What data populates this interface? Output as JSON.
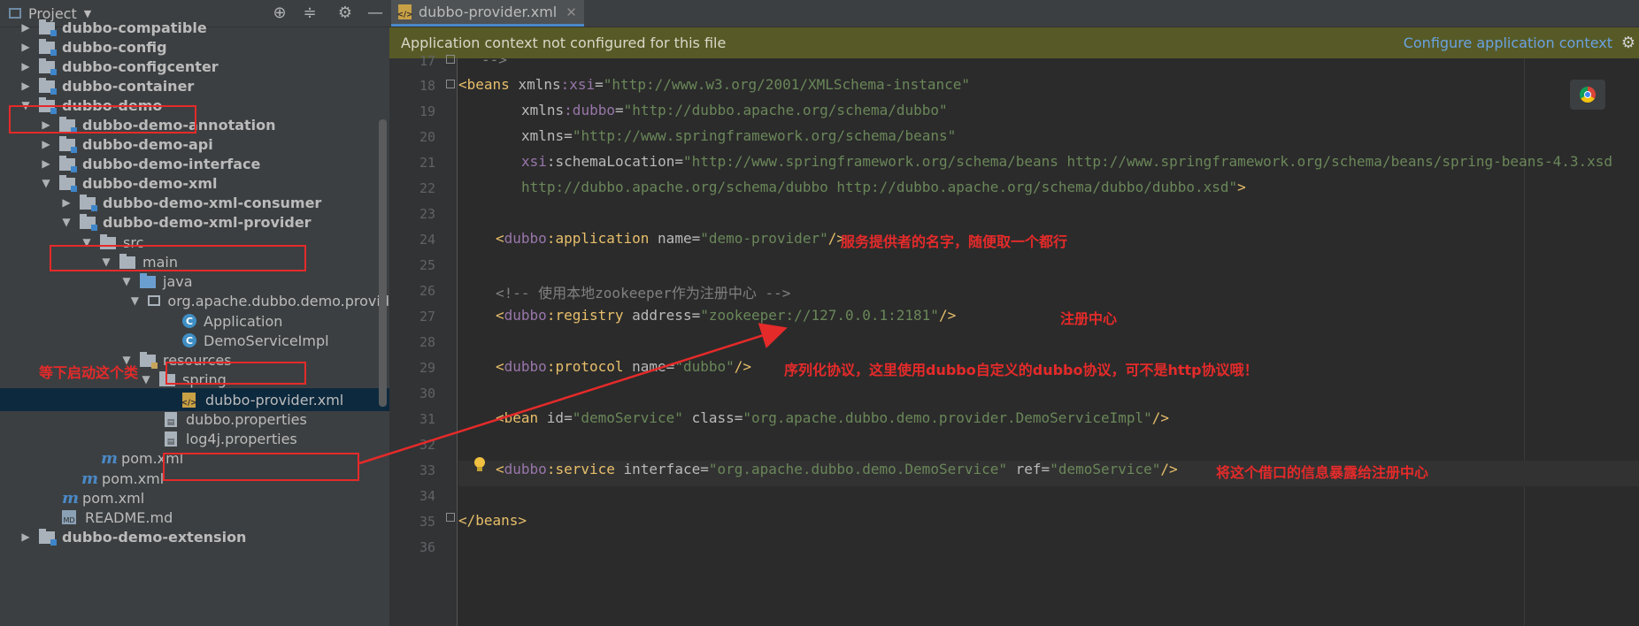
{
  "project_panel": {
    "title": "Project",
    "icons": [
      "target-icon",
      "collapse-all-icon",
      "gear-icon",
      "minimize-icon"
    ],
    "rows": [
      {
        "label": "dubbo-compatible",
        "bold": true
      },
      {
        "label": "dubbo-config",
        "bold": true
      },
      {
        "label": "dubbo-configcenter",
        "bold": true
      },
      {
        "label": "dubbo-container",
        "bold": true
      },
      {
        "label": "dubbo-demo",
        "bold": true
      },
      {
        "label": "dubbo-demo-annotation",
        "bold": true
      },
      {
        "label": "dubbo-demo-api",
        "bold": true
      },
      {
        "label": "dubbo-demo-interface",
        "bold": true
      },
      {
        "label": "dubbo-demo-xml",
        "bold": true
      },
      {
        "label": "dubbo-demo-xml-consumer",
        "bold": true
      },
      {
        "label": "dubbo-demo-xml-provider",
        "bold": true
      },
      {
        "label": "src"
      },
      {
        "label": "main"
      },
      {
        "label": "java"
      },
      {
        "label": "org.apache.dubbo.demo.provid"
      },
      {
        "label": "Application"
      },
      {
        "label": "DemoServiceImpl"
      },
      {
        "label": "resources"
      },
      {
        "label": "spring"
      },
      {
        "label": "dubbo-provider.xml"
      },
      {
        "label": "dubbo.properties"
      },
      {
        "label": "log4j.properties"
      },
      {
        "label": "pom.xml"
      },
      {
        "label": "pom.xml"
      },
      {
        "label": "pom.xml"
      },
      {
        "label": "README.md"
      },
      {
        "label": "dubbo-demo-extension"
      }
    ],
    "annotation": "等下启动这个类"
  },
  "editor": {
    "tab_label": "dubbo-provider.xml",
    "banner_message": "Application context not configured for this file",
    "banner_link": "Configure application context",
    "line_numbers": [
      "17",
      "18",
      "19",
      "20",
      "21",
      "22",
      "23",
      "24",
      "25",
      "26",
      "27",
      "28",
      "29",
      "30",
      "31",
      "32",
      "33",
      "34",
      "35",
      "36"
    ],
    "code": {
      "l17": "-->",
      "l18_tag": "<beans ",
      "l18_ns": "xmlns:xsi",
      "l18_val": "\"http://www.w3.org/2001/XMLSchema-instance\"",
      "l19_ns": "xmlns:dubbo",
      "l19_val": "\"http://dubbo.apache.org/schema/dubbo\"",
      "l20_attr": "xmlns",
      "l20_val": "\"http://www.springframework.org/schema/beans\"",
      "l21_ns": "xsi",
      "l21_attr": ":schemaLocation",
      "l21_val": "\"http://www.springframework.org/schema/beans http://www.springframework.org/schema/beans/spring-beans-4.3.xsd",
      "l22_val": "http://dubbo.apache.org/schema/dubbo http://dubbo.apache.org/schema/dubbo/dubbo.xsd\"",
      "l22_end": ">",
      "l24_tag": "<dubbo",
      "l24_name": ":application ",
      "l24_attr": "name",
      "l24_val": "\"demo-provider\"",
      "l24_end": "/>",
      "l26_comment": "<!-- 使用本地zookeeper作为注册中心 -->",
      "l27_tag": "<dubbo",
      "l27_name": ":registry ",
      "l27_attr": "address",
      "l27_val": "\"zookeeper://127.0.0.1:2181\"",
      "l27_end": "/>",
      "l29_tag": "<dubbo",
      "l29_name": ":protocol ",
      "l29_attr": "name",
      "l29_val": "\"dubbo\"",
      "l29_end": "/>",
      "l31_tag": "<bean ",
      "l31_attr1": "id",
      "l31_val1": "\"demoService\"",
      "l31_attr2": " class",
      "l31_val2": "\"org.apache.dubbo.demo.provider.DemoServiceImpl\"",
      "l31_end": "/>",
      "l33_tag": "<dubbo",
      "l33_name": ":service ",
      "l33_attr1": "interface",
      "l33_val1": "\"org.apache.dubbo.demo.DemoService\"",
      "l33_attr2": " ref",
      "l33_val2": "\"demoService\"",
      "l33_end": "/>",
      "l35": "</beans>"
    },
    "annotations": {
      "a24": "服务提供者的名字，随便取一个都行",
      "a27": "注册中心",
      "a29": "序列化协议，这里使用dubbo自定义的dubbo协议，可不是http协议哦！",
      "a33": "将这个借口的信息暴露给注册中心"
    }
  },
  "colors": {
    "annotation_red": "#e52a2a",
    "banner_bg": "#575a26",
    "link_blue": "#6aa2e0",
    "selection": "#0d293e"
  }
}
